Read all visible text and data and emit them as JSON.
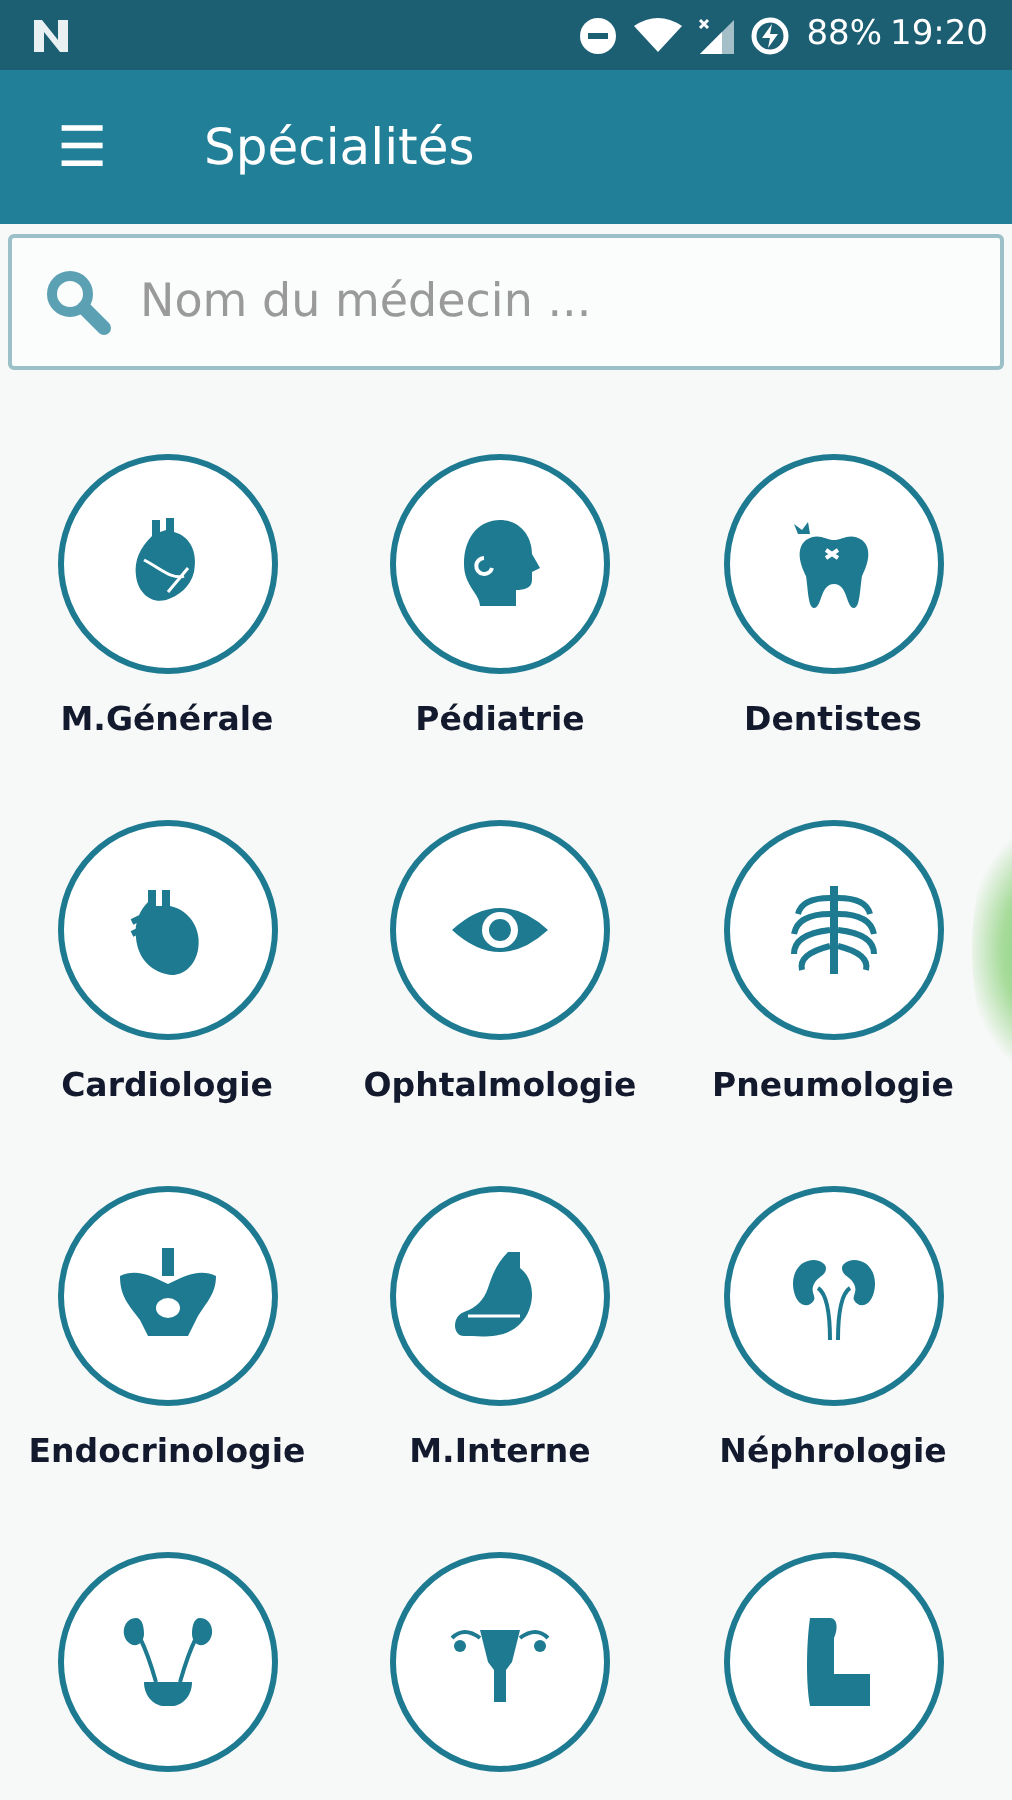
{
  "status_bar": {
    "battery": "88%",
    "time": "19:20"
  },
  "app_bar": {
    "menu_glyph": "☰",
    "title": "Spécialités"
  },
  "search": {
    "placeholder": "Nom du médecin ..."
  },
  "specialties": [
    {
      "kind": "labeled",
      "label": "M.Générale"
    },
    {
      "kind": "labeled",
      "label": "Pédiatrie"
    },
    {
      "kind": "labeled",
      "label": "Dentistes"
    },
    {
      "kind": "labeled",
      "label": "Cardiologie"
    },
    {
      "kind": "labeled",
      "label": "Ophtalmologie"
    },
    {
      "kind": "labeled",
      "label": "Pneumologie"
    },
    {
      "kind": "labeled",
      "label": "Endocrinologie"
    },
    {
      "kind": "labeled",
      "label": "M.Interne"
    },
    {
      "kind": "labeled",
      "label": "Néphrologie"
    },
    {
      "kind": "icon_only"
    },
    {
      "kind": "icon_only"
    },
    {
      "kind": "icon_only"
    }
  ]
}
